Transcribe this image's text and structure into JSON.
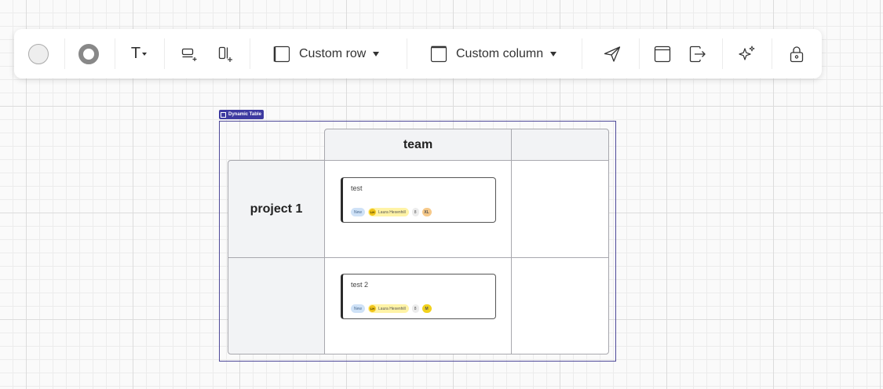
{
  "toolbar": {
    "fill_color": "#eeeeee",
    "border_color": "#888888",
    "text_menu_label": "T",
    "custom_row": {
      "label": "Custom row"
    },
    "custom_column": {
      "label": "Custom column"
    }
  },
  "table": {
    "tag_label": "Dynamic Table",
    "column_headers": [
      "team",
      ""
    ],
    "row_headers": [
      "project 1",
      ""
    ],
    "cards": [
      {
        "title": "test",
        "status": "New",
        "assignee_initials": "LH",
        "assignee_name": "Laura Hexenhill",
        "points": "8",
        "size": "XL",
        "size_color": "#f6c98a"
      },
      {
        "title": "test 2",
        "status": "New",
        "assignee_initials": "LH",
        "assignee_name": "Laura Hexenhill",
        "points": "8",
        "size": "M",
        "size_color": "#f2d21d"
      }
    ]
  }
}
